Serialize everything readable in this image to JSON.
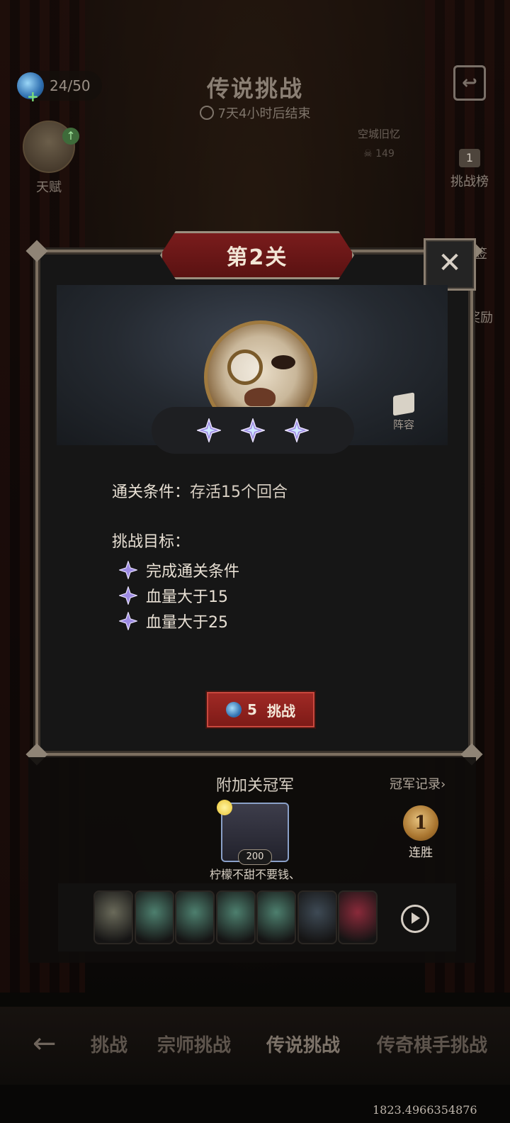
{
  "hud": {
    "energy": "24/50",
    "title": "传说挑战",
    "timer": "7天4小时后结束",
    "talent_label": "天赋",
    "memory_label": "空城旧忆",
    "memory_count": "149",
    "rank_count": "1",
    "rank_label": "挑战榜",
    "side_label_partial": "签",
    "reward_label": "奖励"
  },
  "modal": {
    "level_title": "第2关",
    "close_label": "✕",
    "lineup_label": "阵容",
    "condition_label": "通关条件：",
    "condition_value": "存活15个回合",
    "goals_title": "挑战目标：",
    "goals": [
      "完成通关条件",
      "血量大于15",
      "血量大于25"
    ],
    "challenge_cost": "5",
    "challenge_label": "挑战"
  },
  "champion": {
    "title": "附加关冠军",
    "record_link": "冠军记录›",
    "score": "200",
    "name": "柠檬不甜不要钱、",
    "streak_number": "1",
    "streak_label": "连胜",
    "units": [
      {
        "icon": "wolf-knight",
        "color": "#6a6a5a"
      },
      {
        "icon": "pelican",
        "color": "#4d7f6e"
      },
      {
        "icon": "pelican",
        "color": "#4d7f6e"
      },
      {
        "icon": "pelican",
        "color": "#4d7f6e"
      },
      {
        "icon": "pelican",
        "color": "#4d7f6e"
      },
      {
        "icon": "scarecrow",
        "color": "#3e4a55"
      },
      {
        "icon": "jester",
        "color": "#8a2a3a"
      }
    ]
  },
  "tabs": {
    "items": [
      "挑战",
      "宗师挑战",
      "传说挑战",
      "传奇棋手挑战"
    ],
    "active": "传说挑战"
  },
  "overlay_text": {
    "coordinate": "1823.4966354876"
  },
  "colors": {
    "accent_red": "#7c1a17",
    "star_purple": "#8f7fd8",
    "text_light": "#e8e0d4"
  }
}
